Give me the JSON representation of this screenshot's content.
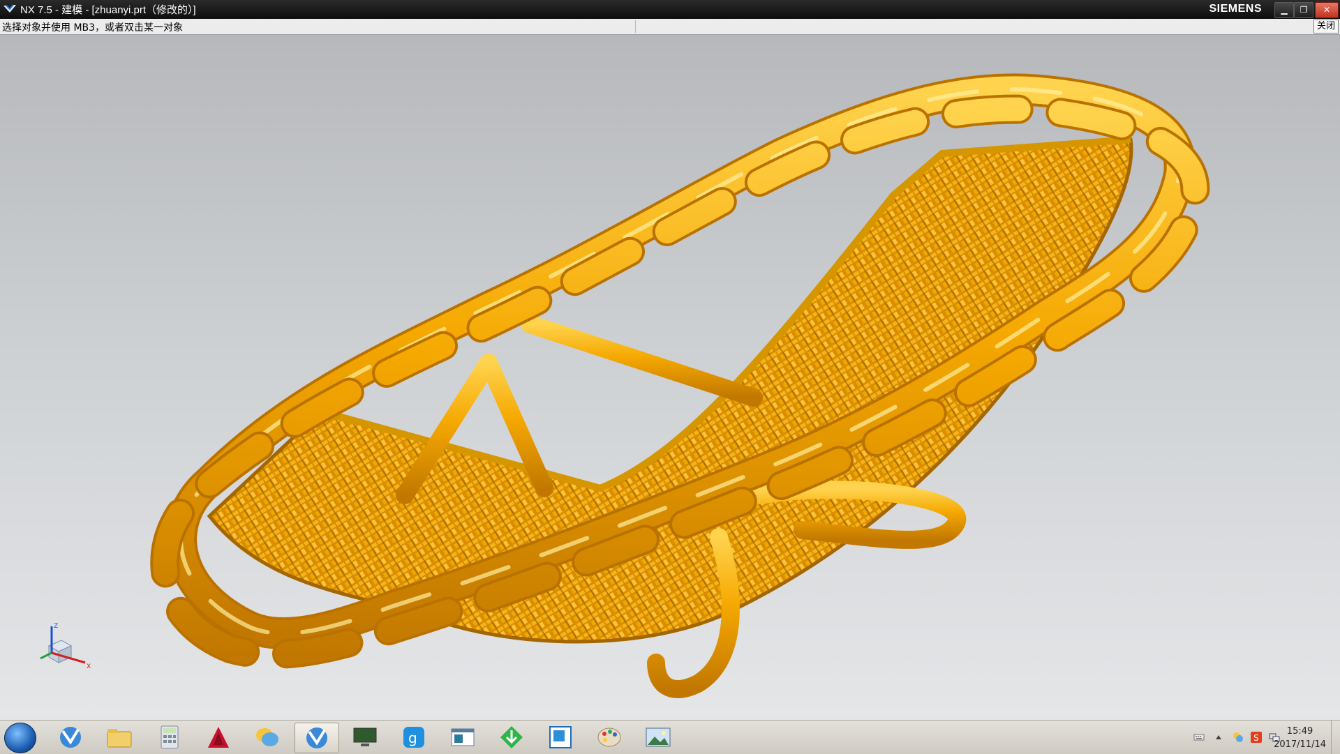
{
  "window": {
    "title": "NX 7.5 - 建模 - [zhuanyi.prt（修改的）]",
    "brand": "SIEMENS",
    "controls": {
      "minimize": "▁",
      "maximize": "❐",
      "close": "✕"
    }
  },
  "cue_line": {
    "text": "选择对象并使用 MB3，或者双击某一对象",
    "close_label": "关闭"
  },
  "viewport": {
    "background_top": "#b6b8bb",
    "background_bottom": "#e5e6e8",
    "model_color": "#f5a800",
    "triad": {
      "z": "Z",
      "x": "X"
    }
  },
  "taskbar": {
    "pinned": [
      {
        "name": "nx-icon",
        "active": false
      },
      {
        "name": "file-explorer-icon",
        "active": false
      },
      {
        "name": "calculator-icon",
        "active": false
      },
      {
        "name": "autocad-icon",
        "active": false
      },
      {
        "name": "chat-bubble-icon",
        "active": false
      },
      {
        "name": "nx-icon",
        "active": true
      },
      {
        "name": "monitor-icon",
        "active": false
      },
      {
        "name": "qq-icon",
        "active": false
      },
      {
        "name": "window-icon",
        "active": false
      },
      {
        "name": "download-arrow-icon",
        "active": false
      },
      {
        "name": "blue-square-icon",
        "active": false
      },
      {
        "name": "paint-palette-icon",
        "active": false
      },
      {
        "name": "photo-viewer-icon",
        "active": false
      }
    ],
    "tray": [
      "keyboard-icon",
      "show-hidden-arrow-icon",
      "chat-bubble-icon",
      "sogou-s-icon",
      "network-icon"
    ],
    "clock": {
      "time": "15:49",
      "date": "2017/11/14"
    }
  }
}
